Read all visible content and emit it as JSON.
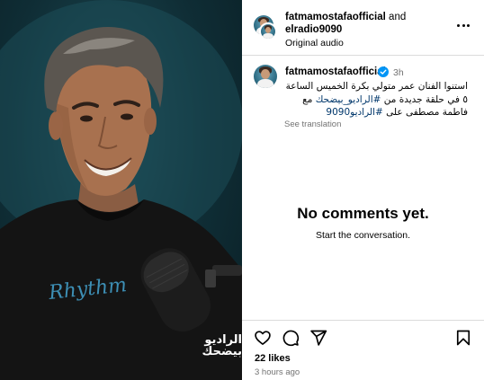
{
  "header": {
    "user1": "fatmamostafaofficial",
    "and_text": "and",
    "user2": "elradio9090",
    "audio": "Original audio",
    "more_icon": "more-horizontal-icon"
  },
  "caption": {
    "username": "fatmamostafaofficial",
    "verified_icon": "verified-badge-icon",
    "time": "3h",
    "line1": "استنوا الفنان عمر متولي بكرة الخميس الساعة",
    "line2_prefix": "٥ في حلقة جديدة من ",
    "line2_tag": "#الراديو_بيضحك",
    "line2_suffix": " مع",
    "line3_prefix": "فاطمة مصطفى على ",
    "line3_tag": "#الراديو9090",
    "see_translation": "See translation"
  },
  "comments": {
    "empty_title": "No comments yet.",
    "empty_subtitle": "Start the conversation."
  },
  "actions": {
    "like_icon": "heart-icon",
    "comment_icon": "comment-icon",
    "share_icon": "share-icon",
    "save_icon": "bookmark-icon",
    "likes": "22 likes",
    "posted": "3 hours ago"
  },
  "media": {
    "shirt_text": "Rhythm",
    "watermark": "الراديو بيضحك"
  },
  "colors": {
    "background": "#ffffff",
    "media_bg": "#0f2d35",
    "hashtag": "#00376b",
    "verified": "#0095f6",
    "muted": "#737373",
    "divider": "#dbdbdb"
  }
}
